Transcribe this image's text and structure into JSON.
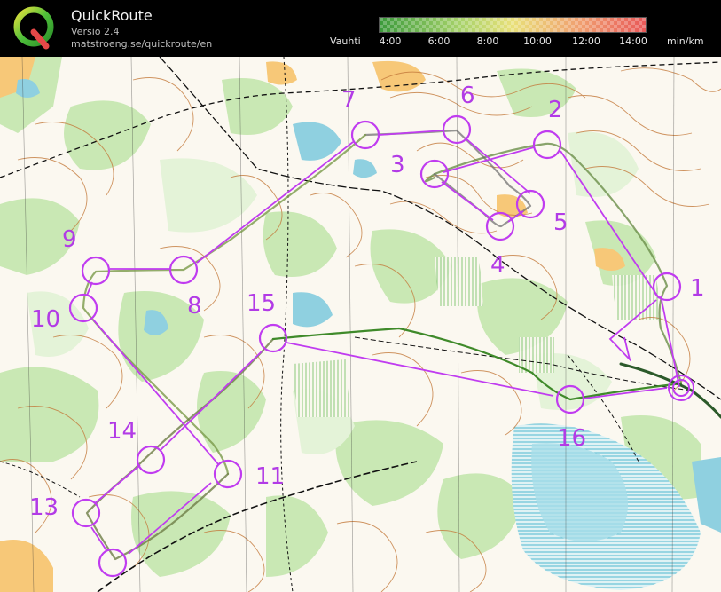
{
  "header": {
    "app_name": "QuickRoute",
    "version": "Versio 2.4",
    "url": "matstroeng.se/quickroute/en",
    "pace_label": "Vauhti",
    "pace_ticks": [
      "4:00",
      "6:00",
      "8:00",
      "10:00",
      "12:00",
      "14:00"
    ],
    "pace_unit": "min/km",
    "logo_letter": "Q"
  },
  "colors": {
    "course": "#c03cf0",
    "route_green": "#3f8a2a",
    "route_red": "#c83c3c",
    "water": "#4fc0d8",
    "vegetation": "#c9e8b4",
    "open_land": "#f7c878",
    "contour": "#c47a3c"
  },
  "controls": [
    {
      "label": "1"
    },
    {
      "label": "2"
    },
    {
      "label": "3"
    },
    {
      "label": "4"
    },
    {
      "label": "5"
    },
    {
      "label": "6"
    },
    {
      "label": "7"
    },
    {
      "label": "8"
    },
    {
      "label": "9"
    },
    {
      "label": "10"
    },
    {
      "label": "11"
    },
    {
      "label": "13"
    },
    {
      "label": "14"
    },
    {
      "label": "15"
    },
    {
      "label": "16"
    }
  ]
}
